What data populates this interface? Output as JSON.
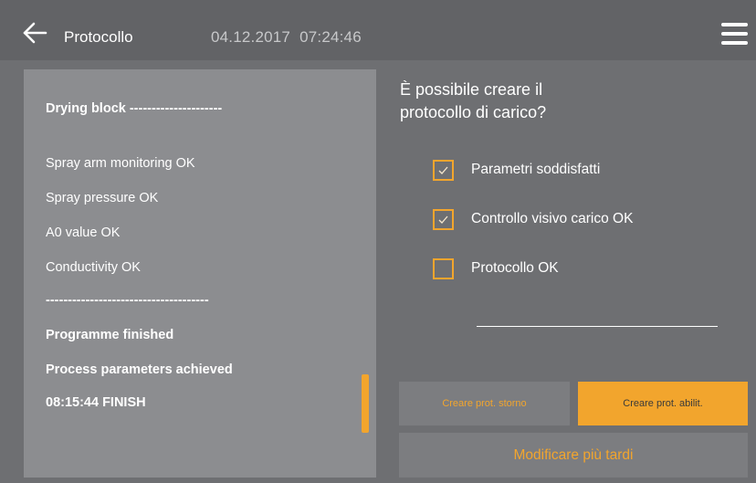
{
  "header": {
    "title": "Protocollo",
    "date": "04.12.2017",
    "time": "07:24:46",
    "back_icon": "arrow-left-icon",
    "menu_icon": "hamburger-menu-icon"
  },
  "log": {
    "lines": [
      "Drying block ---------------------",
      "Spray arm monitoring OK",
      "Spray pressure OK",
      "A0 value OK",
      "Conductivity OK",
      "-------------------------------------",
      "Programme finished",
      "Process parameters achieved",
      "08:15:44 FINISH"
    ]
  },
  "question": {
    "line1": "È possibile creare il",
    "line2": "protocollo di carico?"
  },
  "checks": [
    {
      "label": "Parametri soddisfatti",
      "checked": true
    },
    {
      "label": "Controllo visivo carico OK",
      "checked": true
    },
    {
      "label": "Protocollo OK",
      "checked": false
    }
  ],
  "buttons": {
    "storno": "Creare prot. storno",
    "abilit": "Creare prot. abilit.",
    "later": "Modificare più tardi"
  },
  "colors": {
    "accent": "#f2a52d",
    "background": "#6e6f72",
    "panel": "#8c8d90",
    "header": "#626366"
  }
}
